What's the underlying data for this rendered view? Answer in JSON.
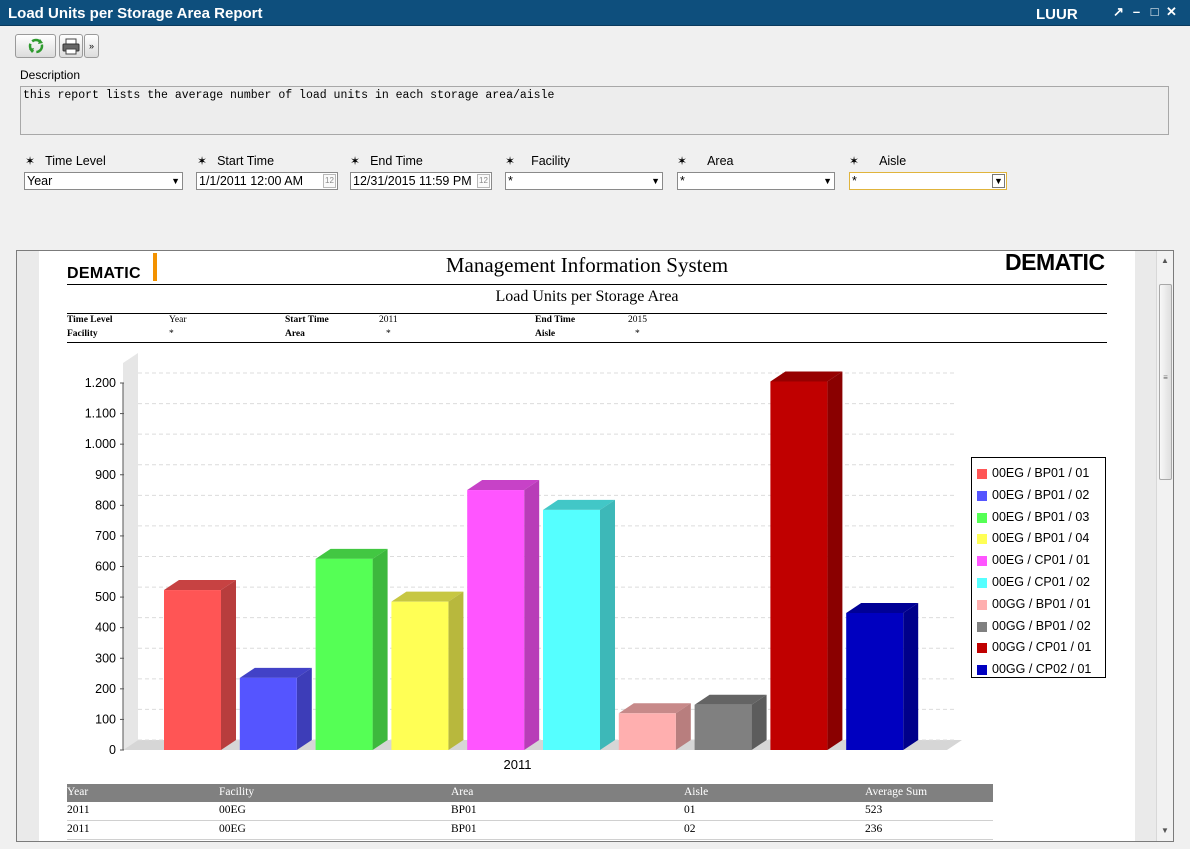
{
  "window": {
    "title": "Load Units per Storage Area Report",
    "user": "LUUR",
    "controls": [
      "↗",
      "–",
      "□",
      "✕"
    ]
  },
  "toolbar": {
    "refresh_icon": "refresh-icon",
    "print_icon": "print-icon",
    "dropdown_glyph": "»"
  },
  "description": {
    "label": "Description",
    "text": "this report lists the average number of load units in each storage area/aisle"
  },
  "params": {
    "required_glyph": "✶",
    "time_level": {
      "label": "Time Level",
      "value": "Year"
    },
    "start_time": {
      "label": "Start Time",
      "value": "1/1/2011 12:00 AM"
    },
    "end_time": {
      "label": "End Time",
      "value": "12/31/2015 11:59 PM"
    },
    "facility": {
      "label": "Facility",
      "value": "*"
    },
    "area": {
      "label": "Area",
      "value": "*"
    },
    "aisle": {
      "label": "Aisle",
      "value": "*"
    }
  },
  "report": {
    "logo_left": "DEMATIC",
    "logo_right": "DEMATIC",
    "title": "Management Information System",
    "subtitle": "Load Units per Storage Area",
    "meta": {
      "time_level_label": "Time Level",
      "time_level_value": "Year",
      "start_time_label": "Start Time",
      "start_time_value": "2011",
      "end_time_label": "End Time",
      "end_time_value": "2015",
      "facility_label": "Facility",
      "facility_value": "*",
      "area_label": "Area",
      "area_value": "*",
      "aisle_label": "Aisle",
      "aisle_value": "*"
    },
    "table": {
      "headers": [
        "Year",
        "Facility",
        "Area",
        "Aisle",
        "Average Sum"
      ],
      "rows": [
        [
          "2011",
          "00EG",
          "BP01",
          "01",
          "523"
        ],
        [
          "2011",
          "00EG",
          "BP01",
          "02",
          "236"
        ]
      ]
    }
  },
  "chart_data": {
    "type": "bar",
    "categories": [
      "2011"
    ],
    "ylim": [
      0,
      1200
    ],
    "yticks": [
      "0",
      "100",
      "200",
      "300",
      "400",
      "500",
      "600",
      "700",
      "800",
      "900",
      "1.000",
      "1.100",
      "1.200"
    ],
    "grid": true,
    "legend_position": "right",
    "series": [
      {
        "name": "00EG / BP01 / 01",
        "values": [
          523
        ],
        "color": "#ff5555"
      },
      {
        "name": "00EG / BP01 / 02",
        "values": [
          236
        ],
        "color": "#5555ff"
      },
      {
        "name": "00EG / BP01 / 03",
        "values": [
          625
        ],
        "color": "#55ff55"
      },
      {
        "name": "00EG / BP01 / 04",
        "values": [
          485
        ],
        "color": "#ffff55"
      },
      {
        "name": "00EG / CP01 / 01",
        "values": [
          850
        ],
        "color": "#ff55ff"
      },
      {
        "name": "00EG / CP01 / 02",
        "values": [
          785
        ],
        "color": "#55ffff"
      },
      {
        "name": "00GG / BP01 / 01",
        "values": [
          120
        ],
        "color": "#ffafaf"
      },
      {
        "name": "00GG / BP01 / 02",
        "values": [
          148
        ],
        "color": "#808080"
      },
      {
        "name": "00GG / CP01 / 01",
        "values": [
          1205
        ],
        "color": "#c00000"
      },
      {
        "name": "00GG / CP02 / 01",
        "values": [
          448
        ],
        "color": "#0000c0"
      }
    ]
  }
}
